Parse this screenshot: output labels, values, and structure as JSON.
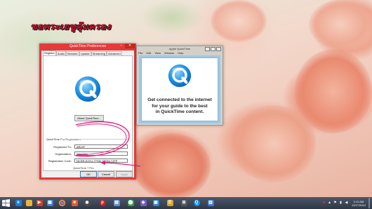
{
  "desktop": {
    "banner_text": "ขอพระเยซูคุ้มครอง"
  },
  "prefs_window": {
    "title": "QuickTime Preferences",
    "tabs": [
      {
        "label": "Register"
      },
      {
        "label": "Audio"
      },
      {
        "label": "Browser"
      },
      {
        "label": "Update"
      },
      {
        "label": "Streaming"
      },
      {
        "label": "Advanced"
      }
    ],
    "about_button": "About QuickTime...",
    "pro_section_label": "QuickTime Pro Registration",
    "registered_to_label": "Registered To:",
    "registered_to_value": "ARIJIT",
    "organization_label": "Organization:",
    "organization_value": "essaylan",
    "reg_code_label": "Registration Code:",
    "reg_code_value": "NCSR-E2YU-77HN-7GDM-TJFP",
    "pro_label": "QuickTime 7 Pro",
    "ok_button": "OK",
    "cancel_button": "Cancel",
    "apply_button": "Apply"
  },
  "qt_window": {
    "title": "Apple QuickTime",
    "menus": [
      "File",
      "Edit",
      "View",
      "Window",
      "Help"
    ],
    "promo_lines": [
      "Get connected to the internet",
      "for your guide to the best",
      "in QuickTime content."
    ]
  },
  "taskbar": {
    "time": "1:11 AM",
    "date": "12/17/2014"
  },
  "colors": {
    "titlebar_active": "#e63a3a",
    "annotation": "#e0177a",
    "qt_blue": "#1a8fe3",
    "taskbar": "#3c4657"
  }
}
